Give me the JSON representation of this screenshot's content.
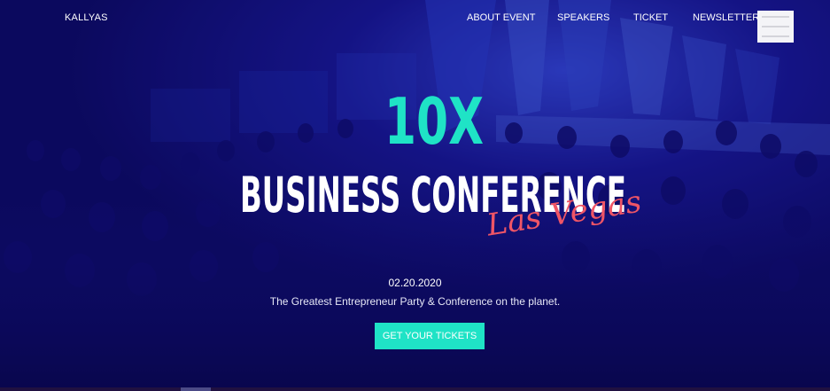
{
  "brand": {
    "logo_text": "KALLYAS"
  },
  "nav": {
    "items": [
      {
        "label": "ABOUT EVENT"
      },
      {
        "label": "SPEAKERS"
      },
      {
        "label": "TICKET"
      },
      {
        "label": "NEWSLETTER"
      }
    ],
    "menu_icon": "hamburger-icon"
  },
  "hero": {
    "headline_top": "10X",
    "headline_main": "BUSINESS CONFERENCE",
    "headline_script": "Las Vegas",
    "date": "02.20.2020",
    "tagline": "The Greatest Entrepreneur Party & Conference on the planet.",
    "cta_label": "GET YOUR TICKETS"
  },
  "colors": {
    "overlay": "#0c0a5c",
    "accent_teal": "#1fe3c6",
    "accent_script": "#ef5566",
    "text": "#ffffff"
  }
}
